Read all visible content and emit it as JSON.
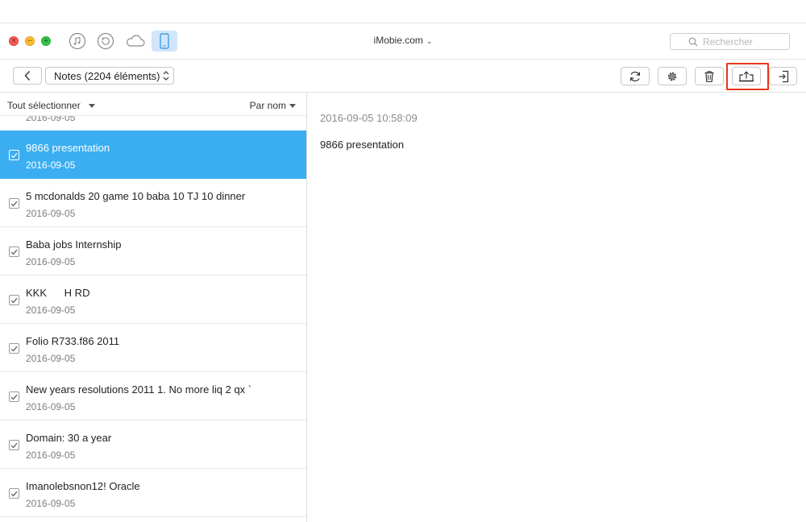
{
  "title": {
    "app_title": "iMobie.com",
    "search_placeholder": "Rechercher",
    "toolbar_icons": [
      "music-icon",
      "restore-icon",
      "cloud-icon",
      "phone-icon"
    ]
  },
  "toolbar": {
    "category_select": "Notes (2204 éléments)",
    "buttons": [
      "refresh-icon",
      "settings-icon",
      "trash-icon",
      "export-icon",
      "import-icon"
    ],
    "highlight_color": "#e8361c"
  },
  "list": {
    "select_all_label": "Tout sélectionner",
    "sort_label": "Par nom",
    "partial_item_date": "2016-09-05",
    "selected_color": "#3aaef1",
    "items": [
      {
        "title": "9866 presentation",
        "date": "2016-09-05",
        "selected": true,
        "checked": true
      },
      {
        "title": "5 mcdonalds 20 game 10 baba 10 TJ 10 dinner",
        "date": "2016-09-05",
        "selected": false,
        "checked": true
      },
      {
        "title": "Baba jobs Internship",
        "date": "2016-09-05",
        "selected": false,
        "checked": true
      },
      {
        "title": "KKK      H RD",
        "date": "2016-09-05",
        "selected": false,
        "checked": true
      },
      {
        "title": "Folio R733.f86 2011",
        "date": "2016-09-05",
        "selected": false,
        "checked": true
      },
      {
        "title": "New years resolutions 2011 1. No more liq 2 qx `",
        "date": "2016-09-05",
        "selected": false,
        "checked": true
      },
      {
        "title": "Domain: 30 a year",
        "date": "2016-09-05",
        "selected": false,
        "checked": true
      },
      {
        "title": "Imanolebsnon12! Oracle",
        "date": "2016-09-05",
        "selected": false,
        "checked": true
      }
    ]
  },
  "detail": {
    "timestamp": "2016-09-05 10:58:09",
    "body": "9866 presentation"
  }
}
